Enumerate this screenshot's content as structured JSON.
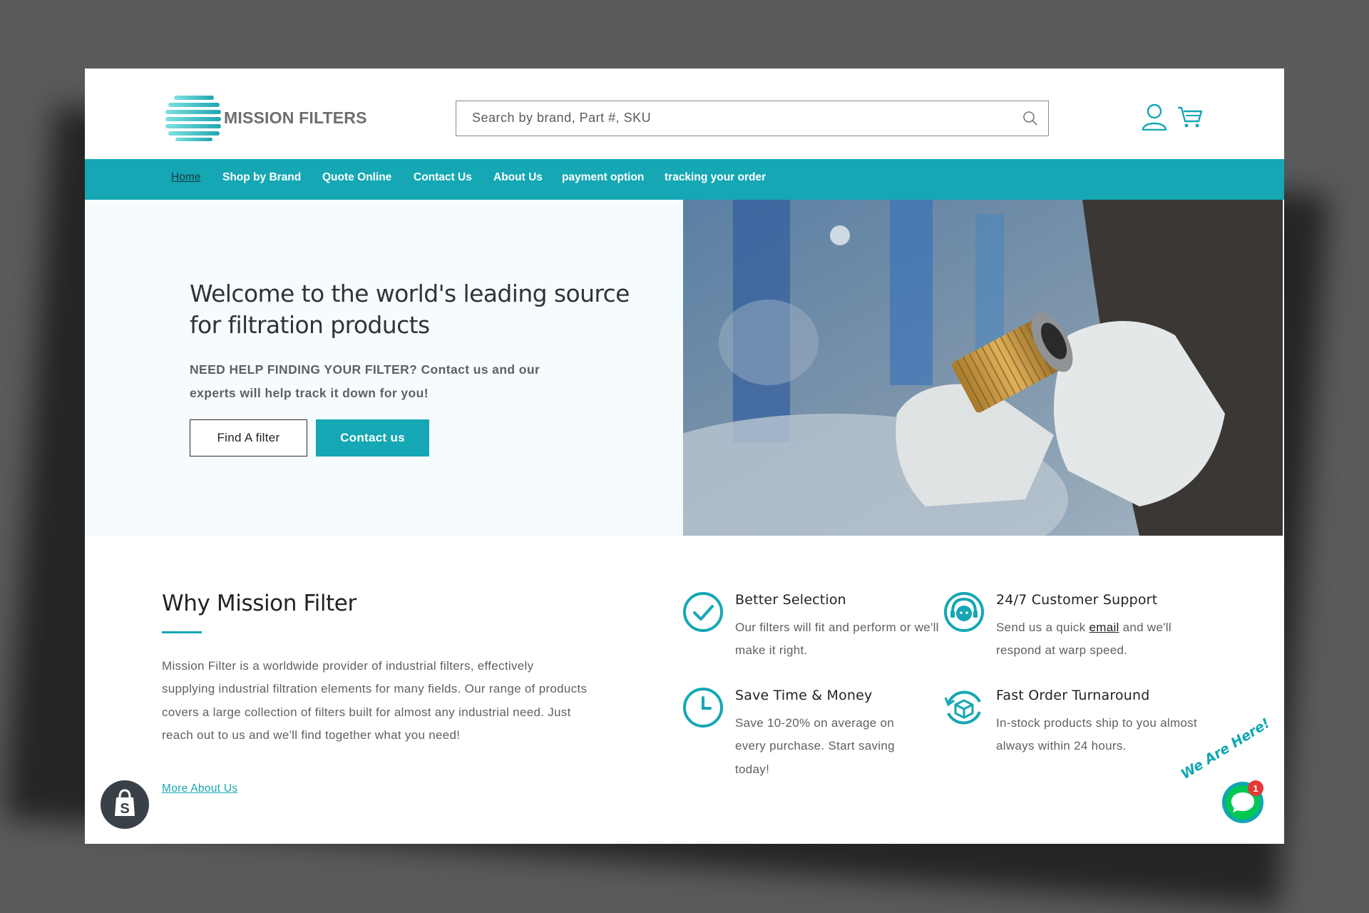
{
  "brand": {
    "name": "MISSION FILTERS",
    "accent": "#15a7b4"
  },
  "search": {
    "placeholder": "Search by brand, Part #, SKU",
    "value": ""
  },
  "nav": [
    {
      "label": "Home",
      "active": true
    },
    {
      "label": "Shop by Brand"
    },
    {
      "label": "Quote Online"
    },
    {
      "label": "Contact Us"
    },
    {
      "label": "About Us"
    },
    {
      "label": "payment option"
    },
    {
      "label": "tracking your order"
    }
  ],
  "hero": {
    "title": "Welcome to the world's leading source for filtration products",
    "subtitle": "NEED HELP FINDING YOUR FILTER? Contact us and our experts will help track it down for you!",
    "btn_find": "Find A filter",
    "btn_contact": "Contact us"
  },
  "why": {
    "title": "Why Mission Filter",
    "text": "Mission Filter is a worldwide provider of industrial filters, effectively supplying industrial filtration elements for many fields. Our range of products covers a large collection of filters built for almost any industrial need. Just reach out to us and we'll find together what you need!",
    "more_link": "More About Us"
  },
  "features": [
    {
      "icon": "check-circle-icon",
      "title": "Better Selection",
      "desc": "Our filters will fit and perform or we'll make it right."
    },
    {
      "icon": "support-agent-icon",
      "title": "24/7 Customer Support",
      "desc_before": "Send us a quick ",
      "link": "email",
      "desc_after": " and we'll respond at warp speed."
    },
    {
      "icon": "clock-icon",
      "title": "Save Time & Money",
      "desc": "Save 10-20% on average on every purchase. Start saving today!"
    },
    {
      "icon": "box-refresh-icon",
      "title": "Fast Order Turnaround",
      "desc": "In-stock products ship to you almost always within 24 hours."
    }
  ],
  "chat": {
    "label": "We Are Here!",
    "badge": "1"
  }
}
